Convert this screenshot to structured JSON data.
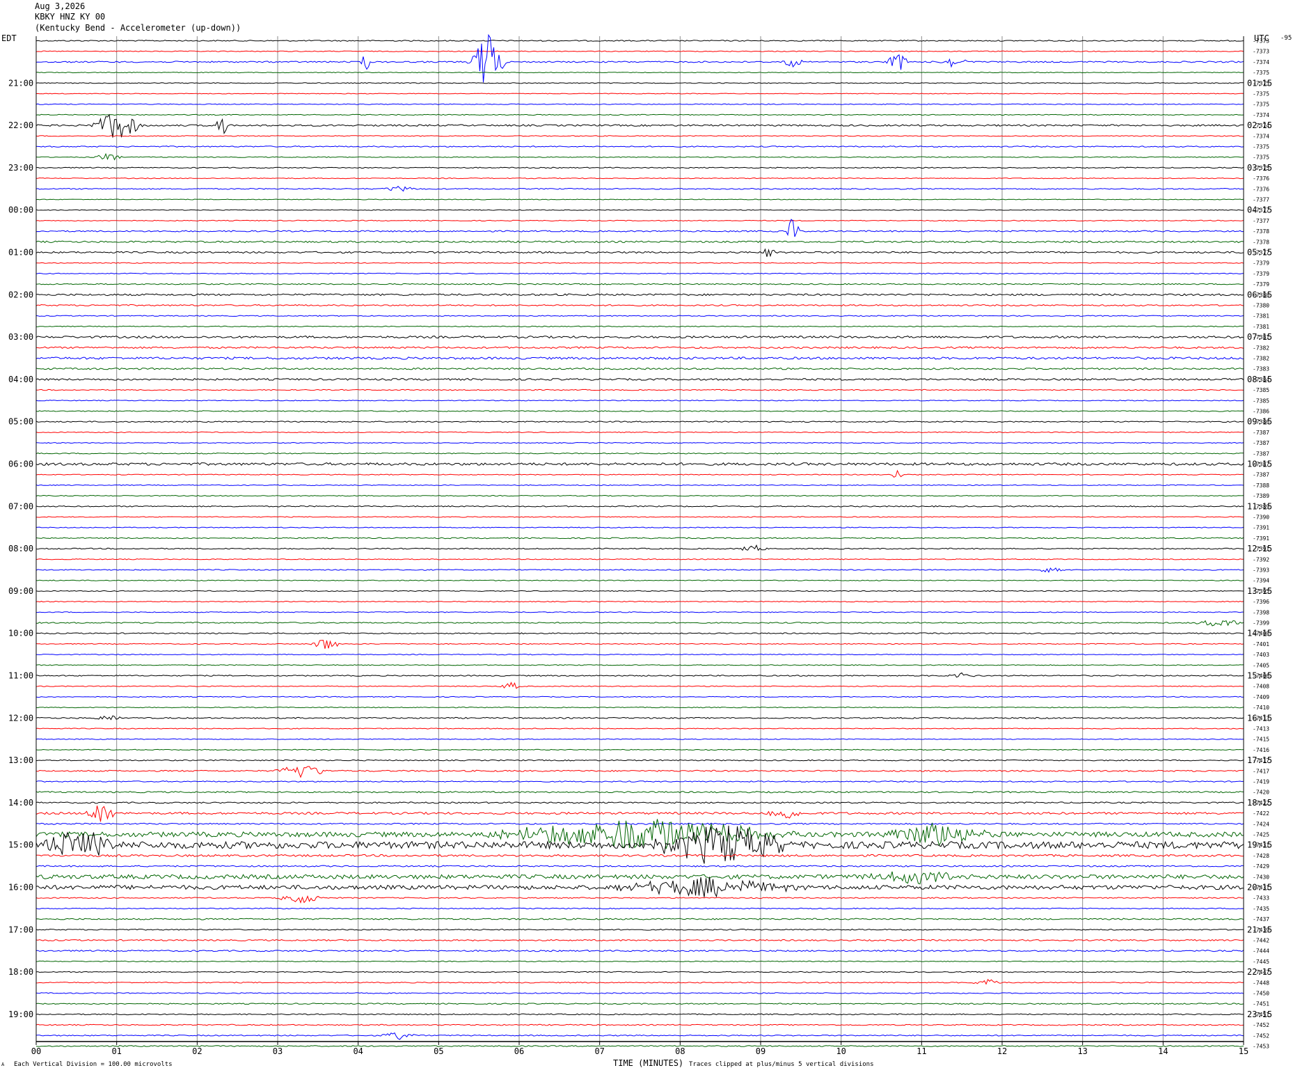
{
  "header": {
    "date": "Aug 3,2026",
    "station": "KBKY HNZ KY 00",
    "description": "(Kentucky Bend - Accelerometer (up-down))"
  },
  "chart_data": {
    "type": "line",
    "title": "Aug 3,2026 KBKY HNZ KY 00 (Kentucky Bend - Accelerometer (up-down))",
    "left_axis_label": "EDT",
    "right_axis_label": "UTC",
    "top_right_mark": "-95",
    "xlabel": "TIME (MINUTES)",
    "xlim": [
      0,
      15
    ],
    "x_ticks": [
      "00",
      "01",
      "02",
      "03",
      "04",
      "05",
      "06",
      "07",
      "08",
      "09",
      "10",
      "11",
      "12",
      "13",
      "14",
      "15"
    ],
    "left_hour_labels": [
      "21:00",
      "22:00",
      "23:00",
      "00:00",
      "01:00",
      "02:00",
      "03:00",
      "04:00",
      "05:00",
      "06:00",
      "07:00",
      "08:00",
      "09:00",
      "10:00",
      "11:00",
      "12:00",
      "13:00",
      "14:00",
      "15:00",
      "16:00",
      "17:00",
      "18:00",
      "19:00"
    ],
    "right_hour_labels": [
      "01:15",
      "02:15",
      "03:15",
      "04:15",
      "05:15",
      "06:15",
      "07:15",
      "08:15",
      "09:15",
      "10:15",
      "11:15",
      "12:15",
      "13:15",
      "14:15",
      "15:15",
      "16:15",
      "17:15",
      "18:15",
      "19:15",
      "20:15",
      "21:15",
      "22:15",
      "23:15"
    ],
    "trace_colors": [
      "#000000",
      "#ff0000",
      "#0000ff",
      "#006400"
    ],
    "traces_per_hour": 4,
    "trace_count": 96,
    "trace_offsets": [
      "-7373",
      "-7373",
      "-7374",
      "-7375",
      "-7375",
      "-7375",
      "-7375",
      "-7374",
      "-7374",
      "-7374",
      "-7375",
      "-7375",
      "-7375",
      "-7376",
      "-7376",
      "-7377",
      "-7377",
      "-7377",
      "-7378",
      "-7378",
      "-7377",
      "-7379",
      "-7379",
      "-7379",
      "-7380",
      "-7380",
      "-7381",
      "-7381",
      "-7381",
      "-7382",
      "-7382",
      "-7383",
      "-7384",
      "-7385",
      "-7385",
      "-7386",
      "-7386",
      "-7387",
      "-7387",
      "-7387",
      "-7387",
      "-7387",
      "-7388",
      "-7389",
      "-7389",
      "-7390",
      "-7391",
      "-7391",
      "-7391",
      "-7392",
      "-7393",
      "-7394",
      "-7395",
      "-7396",
      "-7398",
      "-7399",
      "-7400",
      "-7401",
      "-7403",
      "-7405",
      "-7406",
      "-7408",
      "-7409",
      "-7410",
      "-7413",
      "-7413",
      "-7415",
      "-7416",
      "-7417",
      "-7417",
      "-7419",
      "-7420",
      "-7422",
      "-7422",
      "-7424",
      "-7425",
      "-7431",
      "-7428",
      "-7429",
      "-7430",
      "-7431",
      "-7433",
      "-7435",
      "-7437",
      "-7439",
      "-7442",
      "-7444",
      "-7445",
      "-7447",
      "-7448",
      "-7450",
      "-7451",
      "-7451",
      "-7452",
      "-7452",
      "-7453"
    ],
    "trace_noise_levels": [
      0.8,
      0.6,
      1.0,
      0.5,
      0.6,
      0.5,
      0.6,
      0.6,
      1.2,
      0.6,
      0.8,
      0.6,
      0.7,
      0.6,
      0.8,
      0.5,
      0.5,
      0.6,
      1.0,
      1.2,
      1.2,
      0.6,
      0.6,
      0.8,
      1.3,
      1.0,
      0.7,
      0.6,
      1.5,
      1.3,
      1.6,
      1.2,
      1.3,
      0.7,
      0.6,
      0.7,
      0.8,
      0.6,
      0.6,
      0.7,
      1.8,
      0.6,
      0.6,
      0.6,
      0.8,
      0.6,
      0.6,
      0.8,
      0.8,
      0.6,
      0.7,
      0.6,
      0.6,
      0.6,
      0.6,
      0.8,
      0.8,
      0.6,
      0.6,
      0.6,
      0.8,
      0.6,
      0.6,
      0.6,
      0.9,
      0.6,
      0.6,
      0.6,
      0.8,
      1.0,
      0.8,
      1.0,
      1.0,
      1.5,
      1.0,
      3.5,
      5.0,
      1.5,
      1.0,
      3.0,
      3.0,
      0.8,
      0.7,
      1.0,
      0.8,
      1.0,
      1.0,
      0.6,
      0.7,
      0.7,
      0.7,
      0.8,
      0.8,
      0.8,
      0.8,
      0.8
    ],
    "events": [
      {
        "trace": 2,
        "minute": 5.6,
        "amp": 45,
        "dur": 0.4
      },
      {
        "trace": 2,
        "minute": 4.1,
        "amp": 20,
        "dur": 0.05
      },
      {
        "trace": 2,
        "minute": 10.7,
        "amp": 15,
        "dur": 0.2
      },
      {
        "trace": 2,
        "minute": 11.4,
        "amp": 10,
        "dur": 0.3
      },
      {
        "trace": 2,
        "minute": 9.4,
        "amp": 10,
        "dur": 0.2
      },
      {
        "trace": 8,
        "minute": 1.0,
        "amp": 25,
        "dur": 0.6
      },
      {
        "trace": 8,
        "minute": 2.3,
        "amp": 18,
        "dur": 0.1
      },
      {
        "trace": 11,
        "minute": 0.9,
        "amp": 6,
        "dur": 0.3
      },
      {
        "trace": 14,
        "minute": 4.5,
        "amp": 4,
        "dur": 0.5
      },
      {
        "trace": 18,
        "minute": 9.4,
        "amp": 22,
        "dur": 0.1
      },
      {
        "trace": 20,
        "minute": 9.1,
        "amp": 8,
        "dur": 0.1
      },
      {
        "trace": 41,
        "minute": 10.7,
        "amp": 8,
        "dur": 0.05
      },
      {
        "trace": 48,
        "minute": 8.9,
        "amp": 6,
        "dur": 0.3
      },
      {
        "trace": 50,
        "minute": 12.6,
        "amp": 6,
        "dur": 0.3
      },
      {
        "trace": 55,
        "minute": 14.7,
        "amp": 6,
        "dur": 0.6
      },
      {
        "trace": 57,
        "minute": 3.6,
        "amp": 10,
        "dur": 0.3
      },
      {
        "trace": 60,
        "minute": 11.5,
        "amp": 5,
        "dur": 0.3
      },
      {
        "trace": 61,
        "minute": 5.9,
        "amp": 6,
        "dur": 0.2
      },
      {
        "trace": 64,
        "minute": 0.9,
        "amp": 6,
        "dur": 0.3
      },
      {
        "trace": 69,
        "minute": 3.3,
        "amp": 12,
        "dur": 0.6
      },
      {
        "trace": 73,
        "minute": 0.8,
        "amp": 20,
        "dur": 0.3
      },
      {
        "trace": 73,
        "minute": 9.3,
        "amp": 12,
        "dur": 0.4
      },
      {
        "trace": 75,
        "minute": 7.5,
        "amp": 25,
        "dur": 4.0
      },
      {
        "trace": 75,
        "minute": 11.2,
        "amp": 18,
        "dur": 1.5
      },
      {
        "trace": 76,
        "minute": 0.5,
        "amp": 25,
        "dur": 1.0
      },
      {
        "trace": 76,
        "minute": 8.5,
        "amp": 30,
        "dur": 2.0
      },
      {
        "trace": 79,
        "minute": 11.0,
        "amp": 10,
        "dur": 1.5
      },
      {
        "trace": 80,
        "minute": 8.3,
        "amp": 15,
        "dur": 2.5
      },
      {
        "trace": 81,
        "minute": 3.3,
        "amp": 8,
        "dur": 0.6
      },
      {
        "trace": 89,
        "minute": 11.8,
        "amp": 6,
        "dur": 0.3
      },
      {
        "trace": 94,
        "minute": 4.5,
        "amp": 6,
        "dur": 0.4
      }
    ],
    "footer_left": "Each Vertical Division =  100.00 microvolts",
    "footer_mid": "Traces clipped at plus/minus 5 vertical divisions",
    "footer_corner": "A",
    "grid": true
  }
}
